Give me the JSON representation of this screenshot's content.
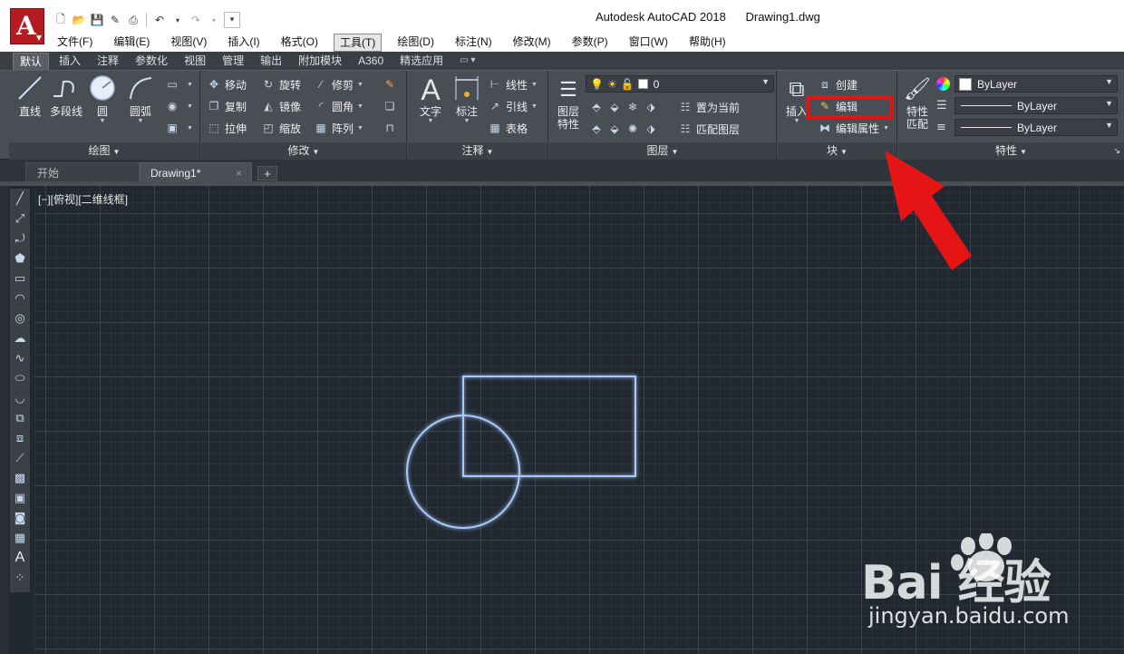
{
  "window": {
    "title": "Autodesk AutoCAD 2018      Drawing1.dwg"
  },
  "menubar": [
    {
      "label": "文件(F)"
    },
    {
      "label": "编辑(E)"
    },
    {
      "label": "视图(V)"
    },
    {
      "label": "插入(I)"
    },
    {
      "label": "格式(O)"
    },
    {
      "label": "工具(T)"
    },
    {
      "label": "绘图(D)"
    },
    {
      "label": "标注(N)"
    },
    {
      "label": "修改(M)"
    },
    {
      "label": "参数(P)"
    },
    {
      "label": "窗口(W)"
    },
    {
      "label": "帮助(H)"
    }
  ],
  "ribbon_tabs": [
    {
      "label": "默认"
    },
    {
      "label": "插入"
    },
    {
      "label": "注释"
    },
    {
      "label": "参数化"
    },
    {
      "label": "视图"
    },
    {
      "label": "管理"
    },
    {
      "label": "输出"
    },
    {
      "label": "附加模块"
    },
    {
      "label": "A360"
    },
    {
      "label": "精选应用"
    }
  ],
  "panels": {
    "draw": {
      "footer": "绘图",
      "line": "直线",
      "polyline": "多段线",
      "circle": "圆",
      "arc": "圆弧"
    },
    "modify": {
      "footer": "修改",
      "move": "移动",
      "rotate": "旋转",
      "trim": "修剪",
      "copy": "复制",
      "mirror": "镜像",
      "fillet": "圆角",
      "stretch": "拉伸",
      "scale": "缩放",
      "array": "阵列"
    },
    "annotation": {
      "footer": "注释",
      "text": "文字",
      "dimension": "标注",
      "linear": "线性",
      "leader": "引线",
      "table": "表格"
    },
    "layers": {
      "footer": "图层",
      "layer_props_1": "图层",
      "layer_props_2": "特性",
      "current_layer": "0",
      "set_current": "置为当前",
      "match_layer": "匹配图层"
    },
    "block": {
      "footer": "块",
      "insert": "插入",
      "create": "创建",
      "edit": "编辑",
      "edit_attributes": "编辑属性"
    },
    "properties": {
      "footer": "特性",
      "match_1": "特性",
      "match_2": "匹配",
      "color": "ByLayer",
      "linetype": "ByLayer",
      "lineweight": "ByLayer"
    }
  },
  "doc_tabs": {
    "start": "开始",
    "drawing": "Drawing1*",
    "close": "×",
    "new": "+"
  },
  "viewport": {
    "label": "[−][俯视][二维线框]"
  },
  "left_toolbar": {
    "text_tool": "A"
  },
  "watermark": {
    "brand": "Bai  经验",
    "url": "jingyan.baidu.com"
  },
  "colors": {
    "canvas": "#212830",
    "geometry": "#a9c8ff",
    "highlight": "#e01515",
    "arrow": "#e01515"
  }
}
